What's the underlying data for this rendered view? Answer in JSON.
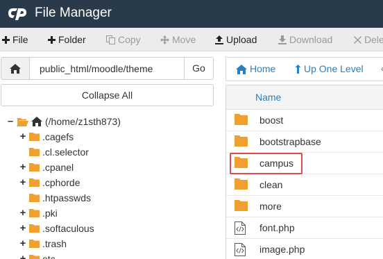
{
  "app": {
    "title": "File Manager",
    "logo": "cpanel-logo"
  },
  "toolbar": {
    "items": [
      {
        "label": "File",
        "icon": "plus-icon",
        "enabled": true
      },
      {
        "label": "Folder",
        "icon": "plus-icon",
        "enabled": true
      },
      {
        "label": "Copy",
        "icon": "copy-icon",
        "enabled": false
      },
      {
        "label": "Move",
        "icon": "move-icon",
        "enabled": false
      },
      {
        "label": "Upload",
        "icon": "upload-icon",
        "enabled": true
      },
      {
        "label": "Download",
        "icon": "download-icon",
        "enabled": false
      },
      {
        "label": "Dele",
        "icon": "delete-icon",
        "enabled": false
      }
    ]
  },
  "path_bar": {
    "value": "public_html/moodle/theme",
    "go_label": "Go"
  },
  "tree": {
    "collapse_label": "Collapse All",
    "root_label": "(/home/z1sth873)",
    "items": [
      {
        "label": ".cagefs",
        "expandable": true
      },
      {
        "label": ".cl.selector",
        "expandable": false
      },
      {
        "label": ".cpanel",
        "expandable": true
      },
      {
        "label": ".cphorde",
        "expandable": true
      },
      {
        "label": ".htpasswds",
        "expandable": false
      },
      {
        "label": ".pki",
        "expandable": true
      },
      {
        "label": ".softaculous",
        "expandable": true
      },
      {
        "label": ".trash",
        "expandable": true
      },
      {
        "label": "etc",
        "expandable": true
      }
    ]
  },
  "nav": {
    "home_label": "Home",
    "up_label": "Up One Level"
  },
  "files": {
    "column_name": "Name",
    "rows": [
      {
        "name": "boost",
        "type": "folder"
      },
      {
        "name": "bootstrapbase",
        "type": "folder"
      },
      {
        "name": "campus",
        "type": "folder",
        "highlighted": true
      },
      {
        "name": "clean",
        "type": "folder"
      },
      {
        "name": "more",
        "type": "folder"
      },
      {
        "name": "font.php",
        "type": "php"
      },
      {
        "name": "image.php",
        "type": "php"
      }
    ]
  },
  "colors": {
    "header": "#293a4a",
    "accent": "#2a7fbe",
    "folder": "#f0a030",
    "highlight": "#e04a4a"
  }
}
